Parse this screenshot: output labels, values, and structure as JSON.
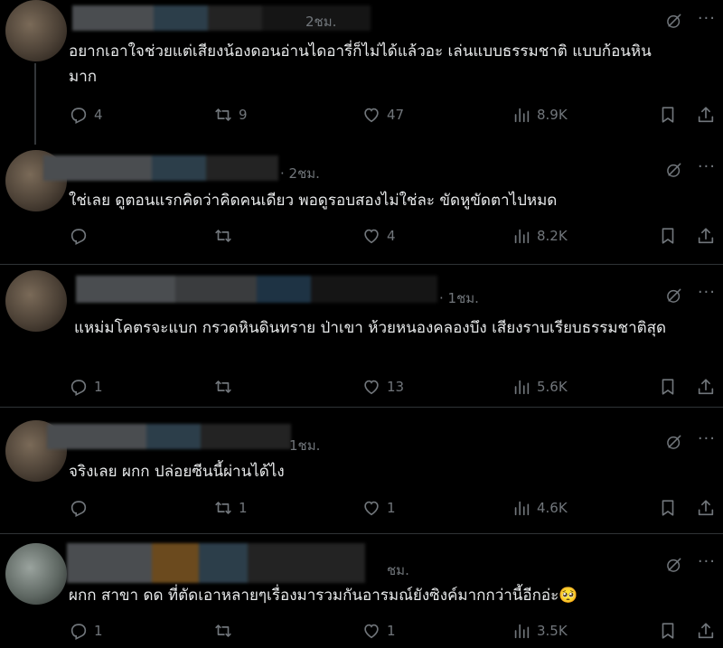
{
  "posts": [
    {
      "time": "2ชม.",
      "text": "อยากเอาใจช่วยแต่เสียงน้องดอนอ่านไดอารี่ก็ไม่ได้แล้วอะ เล่นแบบธรรมชาติ แบบก้อนหินมาก",
      "replies": "4",
      "reposts": "9",
      "likes": "47",
      "views": "8.9K"
    },
    {
      "time": "· 2ชม.",
      "text": "ใช่เลย  ดูตอนแรกคิดว่าคิดคนเดียว พอดูรอบสองไม่ใช่ละ ขัดหูขัดตาไปหมด",
      "replies": "",
      "reposts": "",
      "likes": "4",
      "views": "8.2K"
    },
    {
      "time": "· 1ชม.",
      "text": "แหม่มโคตรจะแบก กรวดหินดินทราย ป่าเขา ห้วยหนองคลองบึง เสียงราบเรียบธรรมชาติสุด",
      "replies": "1",
      "reposts": "",
      "likes": "13",
      "views": "5.6K"
    },
    {
      "time": "1ชม.",
      "text": "จริงเลย ผกก ปล่อยซีนนี้ผ่านได้ไง",
      "replies": "",
      "reposts": "1",
      "likes": "1",
      "views": "4.6K"
    },
    {
      "time": "ชม.",
      "text": "ผกก สาขา ดด ที่ตัดเอาหลายๆเรื่องมารวมกันอารมณ์ยังซิงค์มากกว่านี้อีกอ่ะ🥺",
      "replies": "1",
      "reposts": "",
      "likes": "1",
      "views": "3.5K"
    }
  ],
  "icons": {
    "reply": "reply-icon",
    "repost": "repost-icon",
    "like": "heart-icon",
    "views": "views-icon",
    "bookmark": "bookmark-icon",
    "share": "share-icon",
    "grok": "grok-icon",
    "more": "more-icon"
  },
  "colors": {
    "background": "#000000",
    "text": "#e7e9ea",
    "muted": "#71767b",
    "divider": "#2f3336"
  }
}
